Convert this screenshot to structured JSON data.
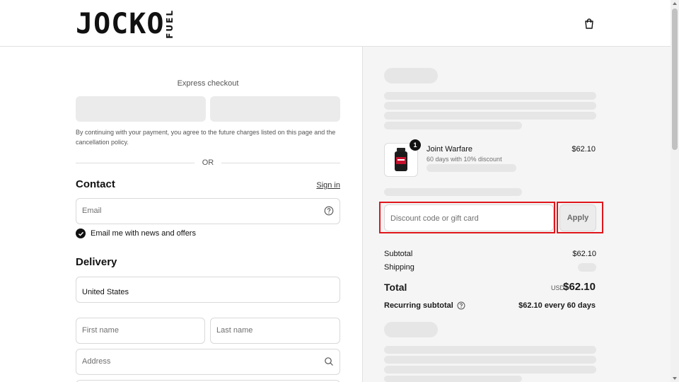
{
  "header": {
    "logo_main": "JOCKO",
    "logo_sub": "FUEL",
    "cart_icon": "shopping-bag-icon"
  },
  "express": {
    "title": "Express checkout",
    "terms": "By continuing with your payment, you agree to the future charges listed on this page and the cancellation policy.",
    "or": "OR"
  },
  "contact": {
    "title": "Contact",
    "signin": "Sign in",
    "email_placeholder": "Email",
    "email_help_icon": "question-circle-icon",
    "newsletter_label": "Email me with news and offers",
    "newsletter_checked": true
  },
  "delivery": {
    "title": "Delivery",
    "country": "United States",
    "first_name_placeholder": "First name",
    "last_name_placeholder": "Last name",
    "address_placeholder": "Address",
    "address_icon": "search-icon"
  },
  "summary": {
    "product": {
      "name": "Joint Warfare",
      "subtitle": "60 days with 10% discount",
      "price": "$62.10",
      "quantity": "1"
    },
    "discount_placeholder": "Discount code or gift card",
    "apply_label": "Apply",
    "subtotal_label": "Subtotal",
    "subtotal_value": "$62.10",
    "shipping_label": "Shipping",
    "total_label": "Total",
    "total_currency": "USD",
    "total_value": "$62.10",
    "recurring_label": "Recurring subtotal",
    "recurring_value": "$62.10 every 60 days"
  },
  "colors": {
    "highlight": "#e0161b",
    "skeleton": "#e6e6e6",
    "summary_bg": "#f5f5f5"
  }
}
